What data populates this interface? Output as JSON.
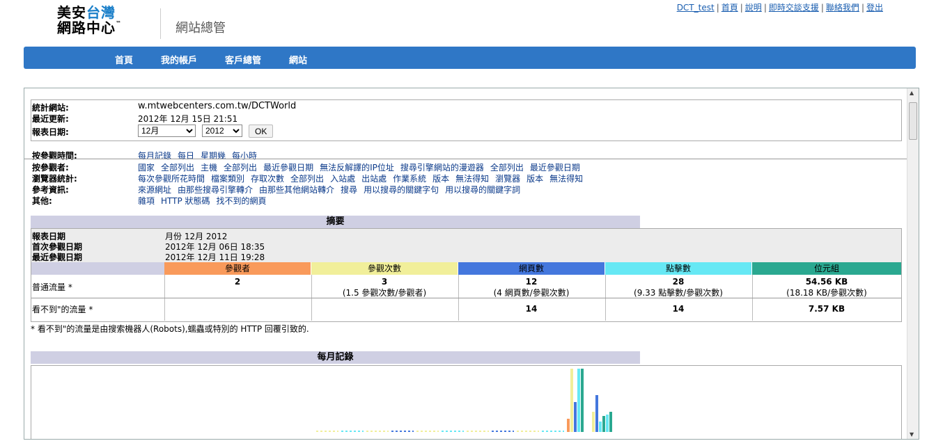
{
  "header": {
    "logo_line1_black": "美安",
    "logo_line1_blue": "台灣",
    "logo_line2": "網路中心",
    "logo_tm": "™",
    "site_title": "網站總管",
    "top_links": [
      "DCT_test",
      "首頁",
      "說明",
      "即時交談支援",
      "聯絡我們",
      "登出"
    ]
  },
  "nav": [
    "首頁",
    "我的帳戶",
    "客戶總管",
    "網站"
  ],
  "info": {
    "site_label": "統計網站:",
    "site_value": "w.mtwebcenters.com.tw/DCTWorld",
    "updated_label": "最近更新:",
    "updated_value": "2012年 12月 15日 21:51",
    "date_label": "報表日期:",
    "month_value": "12月",
    "year_value": "2012",
    "ok_label": "OK"
  },
  "link_groups": [
    {
      "label": "按參觀時間:",
      "links": [
        "每月記錄",
        "每日",
        "星期幾",
        "每小時"
      ]
    },
    {
      "label": "按參觀者:",
      "links": [
        "國家",
        "全部列出",
        "主機",
        "全部列出",
        "最近參觀日期",
        "無法反解譯的IP位址",
        "搜尋引擎網站的漫遊器",
        "全部列出",
        "最近參觀日期"
      ]
    },
    {
      "label": "瀏覽器統計:",
      "links": [
        "每次參觀所花時間",
        "檔案類別",
        "存取次數",
        "全部列出",
        "入站處",
        "出站處",
        "作業系統",
        "版本",
        "無法得知",
        "瀏覽器",
        "版本",
        "無法得知"
      ]
    },
    {
      "label": "參考資訊:",
      "links": [
        "來源網址",
        "由那些搜尋引擎轉介",
        "由那些其他網站轉介",
        "搜尋",
        "用以搜尋的關鍵字句",
        "用以搜尋的關鍵字詞"
      ]
    },
    {
      "label": "其他:",
      "links": [
        "雜項",
        "HTTP 狀態碼",
        "找不到的網頁"
      ]
    }
  ],
  "summary": {
    "title": "摘要",
    "rows": [
      {
        "label": "報表日期",
        "value": "月份 12月 2012"
      },
      {
        "label": "首次參觀日期",
        "value": "2012年 12月 06日 18:35"
      },
      {
        "label": "最近參觀日期",
        "value": "2012年 12月 11日 19:28"
      }
    ],
    "columns": [
      {
        "name": "參觀者",
        "color": "#f99a5b"
      },
      {
        "name": "參觀次數",
        "color": "#f1ef9a"
      },
      {
        "name": "網頁數",
        "color": "#4477dd"
      },
      {
        "name": "點擊數",
        "color": "#66e8f4"
      },
      {
        "name": "位元組",
        "color": "#2aa890"
      }
    ],
    "normal_label": "普通流量 *",
    "normal_values": [
      {
        "main": "2",
        "sub": ""
      },
      {
        "main": "3",
        "sub": "(1.5 參觀次數/參觀者)"
      },
      {
        "main": "12",
        "sub": "(4 網頁數/參觀次數)"
      },
      {
        "main": "28",
        "sub": "(9.33 點擊數/參觀次數)"
      },
      {
        "main": "54.56 KB",
        "sub": "(18.18 KB/參觀次數)"
      }
    ],
    "hidden_label": "看不到\"的流量 *",
    "hidden_values": [
      "",
      "",
      "14",
      "14",
      "7.57 KB"
    ],
    "note": "* 看不到\"的流量是由搜索機器人(Robots),蠕蟲或特別的 HTTP 回覆引致的."
  },
  "monthly": {
    "title": "每月記錄"
  }
}
